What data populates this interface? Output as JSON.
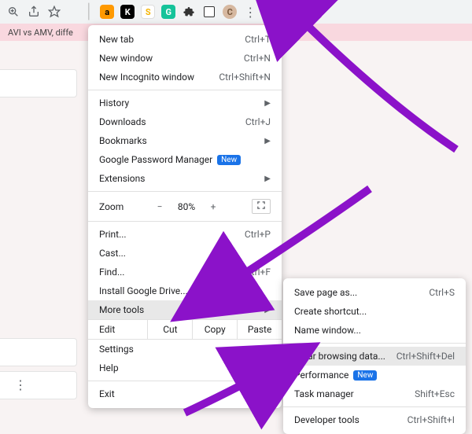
{
  "toolbar": {
    "avatar_letter": "C"
  },
  "tabstrip": {
    "title": "AVI vs AMV, diffe"
  },
  "menu": {
    "new_tab": {
      "label": "New tab",
      "shortcut": "Ctrl+T"
    },
    "new_window": {
      "label": "New window",
      "shortcut": "Ctrl+N"
    },
    "new_incognito": {
      "label": "New Incognito window",
      "shortcut": "Ctrl+Shift+N"
    },
    "history": {
      "label": "History"
    },
    "downloads": {
      "label": "Downloads",
      "shortcut": "Ctrl+J"
    },
    "bookmarks": {
      "label": "Bookmarks"
    },
    "password_manager": {
      "label": "Google Password Manager",
      "badge": "New"
    },
    "extensions": {
      "label": "Extensions"
    },
    "zoom": {
      "label": "Zoom",
      "minus": "−",
      "value": "80%",
      "plus": "+"
    },
    "print": {
      "label": "Print...",
      "shortcut": "Ctrl+P"
    },
    "cast": {
      "label": "Cast..."
    },
    "find": {
      "label": "Find...",
      "shortcut": "Ctrl+F"
    },
    "install_drive": {
      "label": "Install Google Drive..."
    },
    "more_tools": {
      "label": "More tools"
    },
    "edit": {
      "label": "Edit",
      "cut": "Cut",
      "copy": "Copy",
      "paste": "Paste"
    },
    "settings": {
      "label": "Settings"
    },
    "help": {
      "label": "Help"
    },
    "exit": {
      "label": "Exit"
    }
  },
  "submenu": {
    "save_page": {
      "label": "Save page as...",
      "shortcut": "Ctrl+S"
    },
    "create_shortcut": {
      "label": "Create shortcut..."
    },
    "name_window": {
      "label": "Name window..."
    },
    "clear_browsing": {
      "label": "Clear browsing data...",
      "shortcut": "Ctrl+Shift+Del"
    },
    "performance": {
      "label": "Performance",
      "badge": "New"
    },
    "task_manager": {
      "label": "Task manager",
      "shortcut": "Shift+Esc"
    },
    "developer_tools": {
      "label": "Developer tools",
      "shortcut": "Ctrl+Shift+I"
    }
  }
}
